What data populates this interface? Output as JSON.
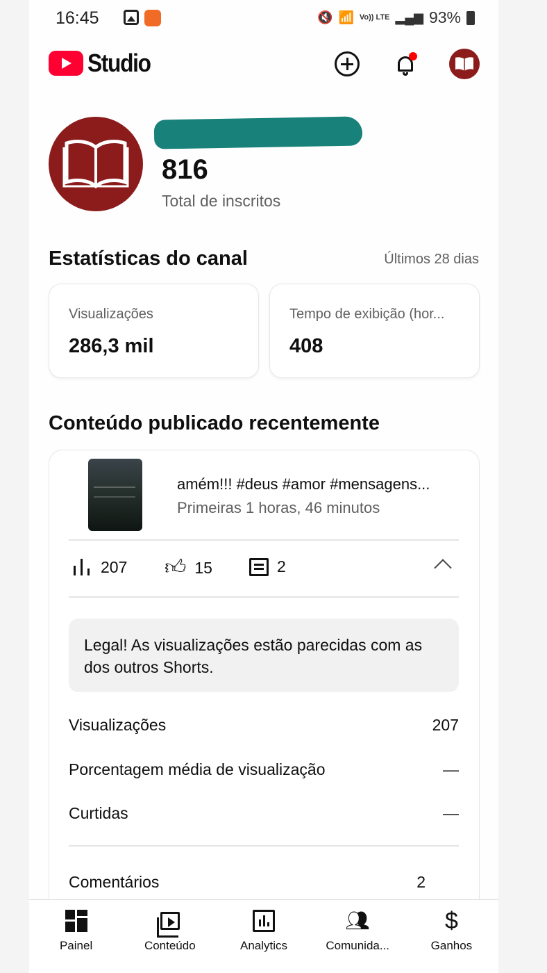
{
  "status_bar": {
    "time": "16:45",
    "battery": "93%",
    "network": "Vo)) LTE"
  },
  "header": {
    "logo_text": "Studio"
  },
  "channel": {
    "subscriber_count": "816",
    "subscriber_label": "Total de inscritos"
  },
  "stats": {
    "title": "Estatísticas do canal",
    "period": "Últimos 28 dias",
    "cards": [
      {
        "label": "Visualizações",
        "value": "286,3 mil"
      },
      {
        "label": "Tempo de exibição (hor...",
        "value": "408"
      }
    ]
  },
  "recent": {
    "title": "Conteúdo publicado recentemente",
    "video": {
      "title": "amém!!! #deus #amor #mensagens...",
      "subtitle": "Primeiras 1 horas, 46 minutos",
      "views": "207",
      "likes": "15",
      "comments": "2"
    },
    "insight": "Legal! As visualizações estão parecidas com as dos outros Shorts.",
    "rows": [
      {
        "label": "Visualizações",
        "value": "207"
      },
      {
        "label": "Porcentagem média de visualização",
        "value": "—"
      },
      {
        "label": "Curtidas",
        "value": "—"
      },
      {
        "label": "Comentários",
        "value": "2"
      }
    ]
  },
  "bottom_nav": [
    {
      "label": "Painel",
      "icon": "dashboard-icon"
    },
    {
      "label": "Conteúdo",
      "icon": "content-icon"
    },
    {
      "label": "Analytics",
      "icon": "analytics-icon"
    },
    {
      "label": "Comunida...",
      "icon": "community-icon"
    },
    {
      "label": "Ganhos",
      "icon": "dollar-icon"
    }
  ],
  "colors": {
    "brand_red": "#ff0033",
    "avatar_bg": "#8c1c1c",
    "redaction": "#17817a",
    "notification_dot": "#ff0000"
  }
}
